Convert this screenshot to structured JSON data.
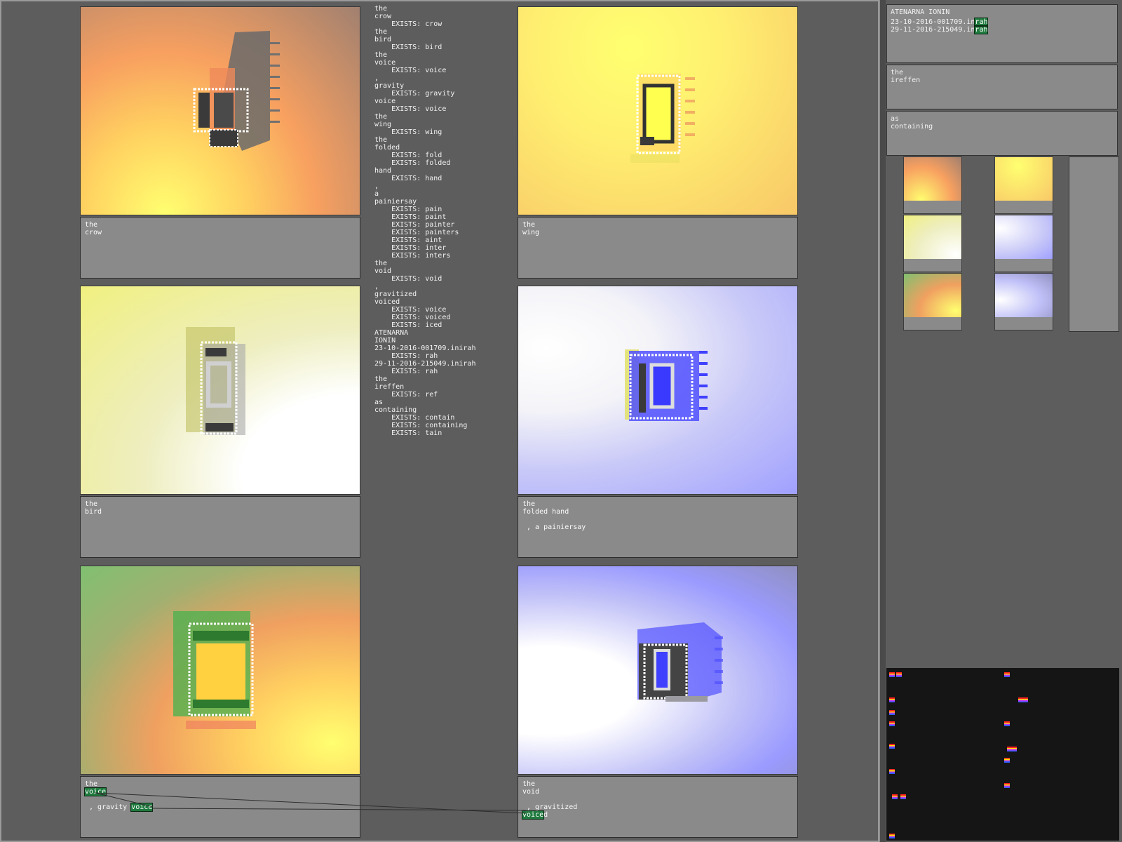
{
  "panels": [
    {
      "caption": [
        "the",
        "crow"
      ]
    },
    {
      "caption": [
        "the",
        "wing"
      ]
    },
    {
      "caption": [
        "the",
        "bird"
      ]
    },
    {
      "caption": [
        "the",
        "folded hand",
        "",
        " , a painiersay"
      ]
    },
    {
      "caption_before": "the",
      "highlight1": "voice",
      "caption_mid": " , gravity ",
      "highlight2": "voice"
    },
    {
      "caption_before": "the",
      "caption_l2": "void",
      "caption_l3": "",
      "caption_l4": " , gravitized",
      "highlight1": "voice",
      "caption_tail": "d"
    }
  ],
  "listing": [
    "the",
    "crow",
    "    EXISTS: crow",
    "the",
    "bird",
    "    EXISTS: bird",
    "the",
    "voice",
    "    EXISTS: voice",
    ",",
    "gravity",
    "    EXISTS: gravity",
    "voice",
    "    EXISTS: voice",
    "the",
    "wing",
    "    EXISTS: wing",
    "the",
    "folded",
    "    EXISTS: fold",
    "    EXISTS: folded",
    "hand",
    "    EXISTS: hand",
    ",",
    "a",
    "painiersay",
    "    EXISTS: pain",
    "    EXISTS: paint",
    "    EXISTS: painter",
    "    EXISTS: painters",
    "    EXISTS: aint",
    "    EXISTS: inter",
    "    EXISTS: inters",
    "the",
    "void",
    "    EXISTS: void",
    ",",
    "gravitized",
    "voiced",
    "    EXISTS: voice",
    "    EXISTS: voiced",
    "    EXISTS: iced",
    "ATENARNA",
    "IONIN",
    "23-10-2016-001709.inirah",
    "    EXISTS: rah",
    "29-11-2016-215049.inirah",
    "    EXISTS: rah",
    "the",
    "ireffen",
    "    EXISTS: ref",
    "as",
    "containing",
    "    EXISTS: contain",
    "    EXISTS: containing",
    "    EXISTS: tain"
  ],
  "right_panel": {
    "title": "ATENARNA IONIN",
    "entries": [
      {
        "prefix": "23-10-2016-001709.in",
        "highlight": "rah"
      },
      {
        "prefix": "29-11-2016-215049.in",
        "highlight": "rah"
      }
    ],
    "box2": [
      "the",
      "ireffen"
    ],
    "box3": [
      "as",
      "containing"
    ]
  },
  "colors": {
    "background": "#5d5d5d",
    "caption_bg": "#8a8a8a",
    "highlight": "#1f7a3e",
    "dark_panel": "#151515"
  }
}
